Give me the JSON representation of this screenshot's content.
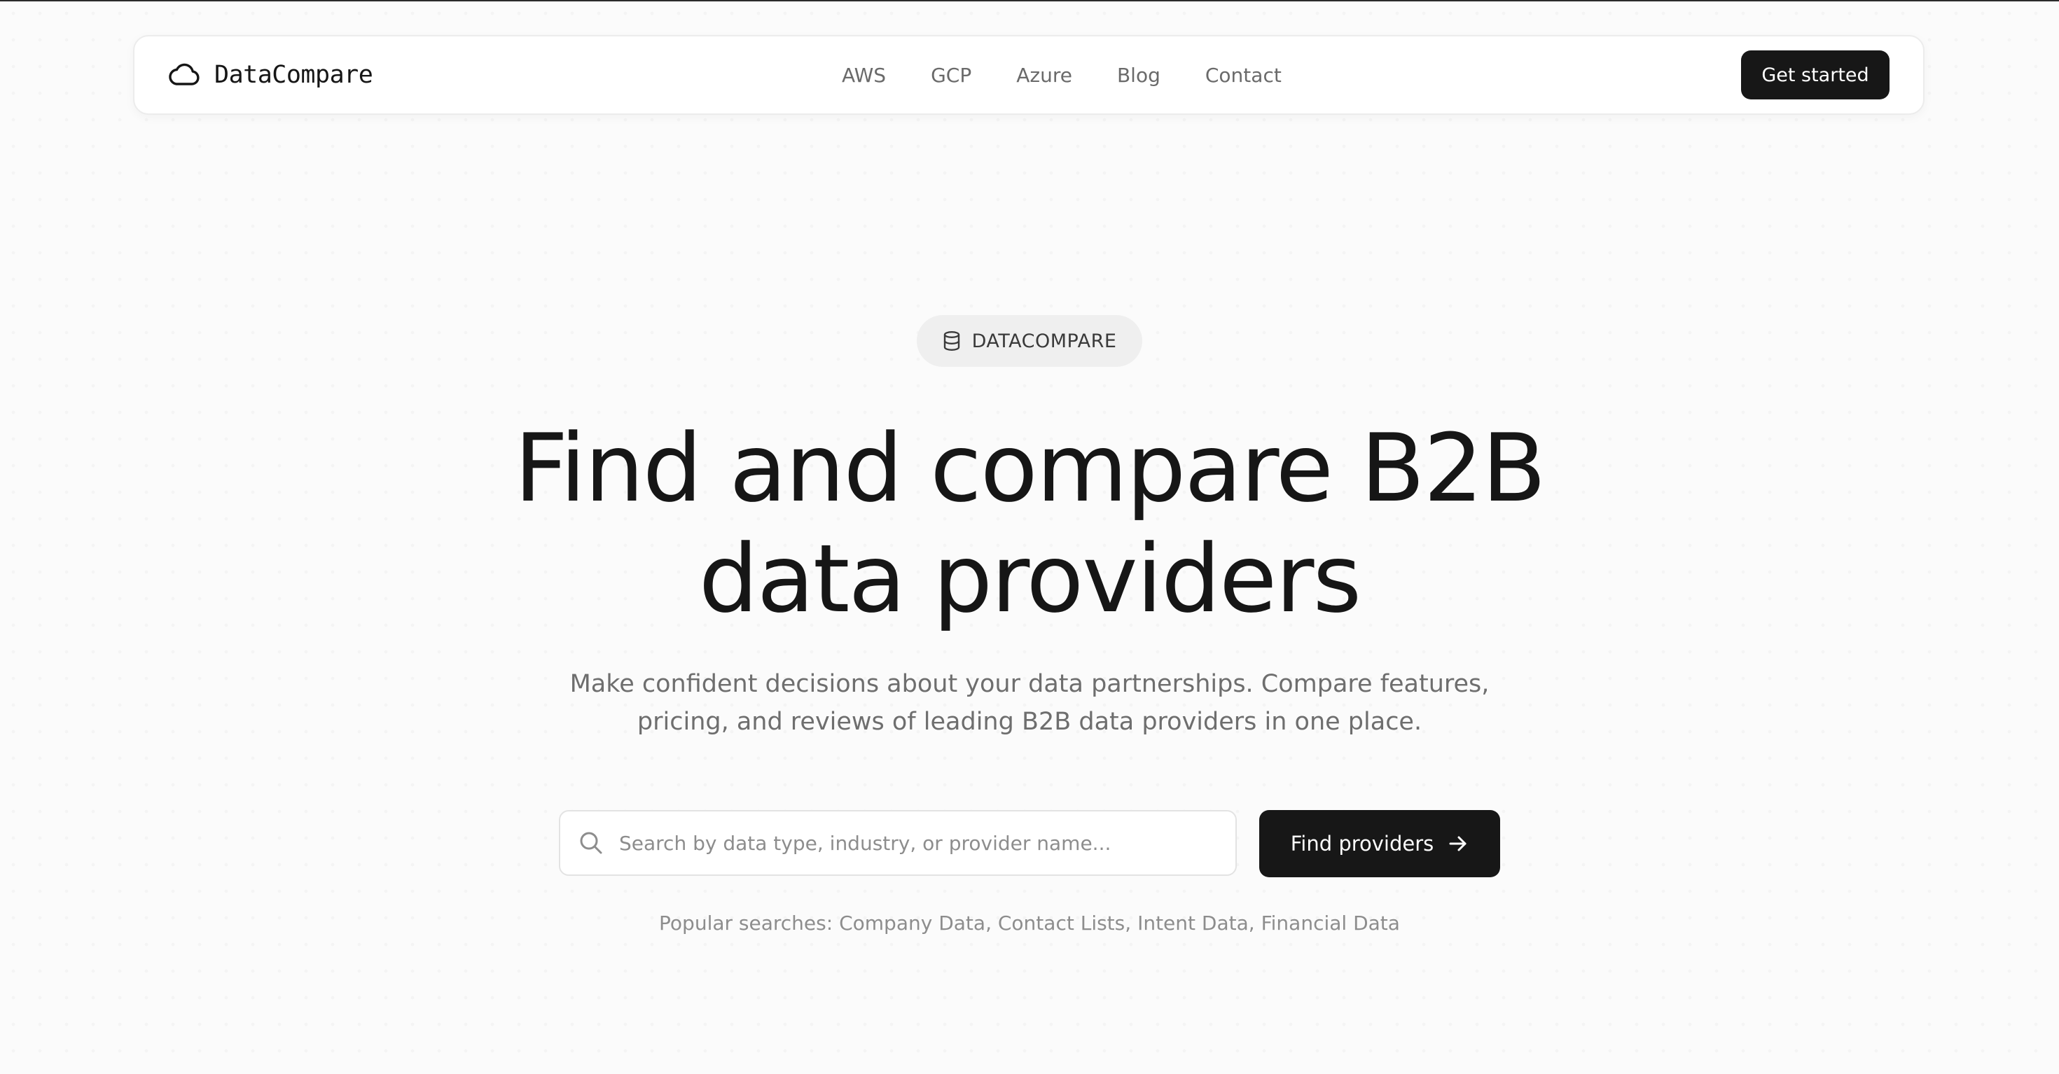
{
  "brand": {
    "name": "DataCompare",
    "icon": "cloud-icon"
  },
  "nav": {
    "links": [
      "AWS",
      "GCP",
      "Azure",
      "Blog",
      "Contact"
    ],
    "cta_label": "Get started"
  },
  "hero": {
    "badge": {
      "icon": "database-icon",
      "label": "DATACOMPARE"
    },
    "title_line1": "Find and compare B2B",
    "title_line2": "data providers",
    "subtitle_line1": "Make confident decisions about your data partnerships. Compare features,",
    "subtitle_line2": "pricing, and reviews of leading B2B data providers in one place."
  },
  "search": {
    "placeholder": "Search by data type, industry, or provider name...",
    "value": "",
    "button_label": "Find providers",
    "button_icon": "arrow-right-icon"
  },
  "popular": {
    "prefix": "Popular searches:",
    "items": [
      "Company Data",
      "Contact Lists",
      "Intent Data",
      "Financial Data"
    ]
  },
  "colors": {
    "primary": "#171717",
    "muted_text": "#6e6e6e",
    "background": "#fbfbfb"
  }
}
